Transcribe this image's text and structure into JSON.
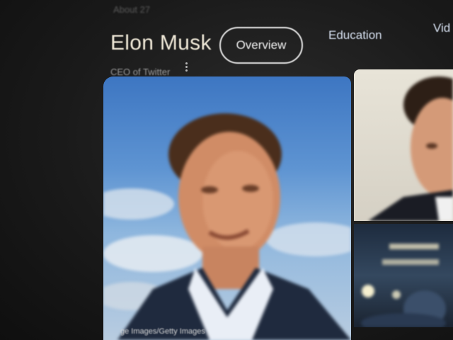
{
  "page": {
    "faint_top_text": "About 27"
  },
  "knowledge_panel": {
    "title": "Elon Musk",
    "subtitle": "CEO of Twitter",
    "more_icon": "more-vertical-icon"
  },
  "tabs": [
    {
      "label": "Overview",
      "active": true
    },
    {
      "label": "Education",
      "active": false
    },
    {
      "label": "Vid",
      "active": false
    }
  ],
  "images": {
    "main_caption": "ge Images/Getty Images",
    "main_alt": "portrait-photo",
    "side_top_alt": "portrait-photo",
    "side_bottom_alt": "event-photo"
  },
  "colors": {
    "background": "#1b1b1b",
    "title": "#f1ead9",
    "tab_text": "#e4e8f0",
    "sky": "#5e94d2"
  }
}
